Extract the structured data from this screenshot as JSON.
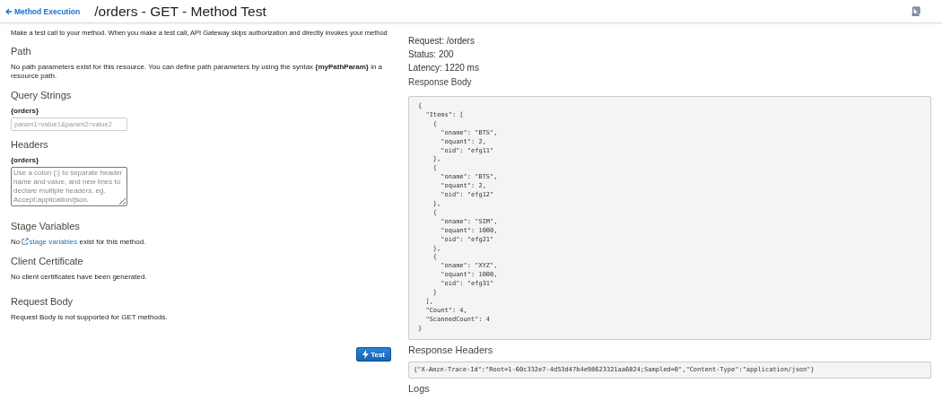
{
  "header": {
    "back_link": "Method Execution",
    "title": "/orders - GET - Method Test"
  },
  "intro": "Make a test call to your method. When you make a test call, API Gateway skips authorization and directly invokes your method",
  "sections": [
    {
      "kind": "text",
      "heading": "Path",
      "text": "No path parameters exist for this resource. You can define path parameters by using the syntax **{myPathParam}** in a resource path."
    },
    {
      "kind": "input",
      "heading": "Query Strings",
      "label": "{orders}",
      "placeholder": "param1=value1&param2=value2"
    },
    {
      "kind": "textarea",
      "heading": "Headers",
      "label": "{orders}",
      "placeholder": "Use a colon (:) to separate header name and value, and new lines to declare multiple headers. eg. Accept:application/json."
    },
    {
      "kind": "link_text",
      "heading": "Stage Variables",
      "before": "No",
      "link": "stage variables",
      "after": "exist for this method."
    },
    {
      "kind": "text",
      "heading": "Client Certificate",
      "text": "No client certificates have been generated."
    },
    {
      "kind": "text",
      "heading": "Request Body",
      "text": "Request Body is not supported for GET methods."
    }
  ],
  "test_button": "Test",
  "result": {
    "request": "Request: /orders",
    "status": "Status: 200",
    "latency": "Latency: 1220 ms",
    "body_heading": "Response Body",
    "body": "{\n  \"Items\": [\n    {\n      \"oname\": \"BTS\",\n      \"oquant\": 2,\n      \"oid\": \"efg11\"\n    },\n    {\n      \"oname\": \"BTS\",\n      \"oquant\": 2,\n      \"oid\": \"efg12\"\n    },\n    {\n      \"oname\": \"SIM\",\n      \"oquant\": 1000,\n      \"oid\": \"efg21\"\n    },\n    {\n      \"oname\": \"XYZ\",\n      \"oquant\": 1000,\n      \"oid\": \"efg31\"\n    }\n  ],\n  \"Count\": 4,\n  \"ScannedCount\": 4\n}",
    "headers_heading": "Response Headers",
    "headers": "{\"X-Amzn-Trace-Id\":\"Root=1-60c332e7-4d53d47b4e98623321aa6024;Sampled=0\",\"Content-Type\":\"application/json\"}",
    "logs_heading": "Logs"
  }
}
